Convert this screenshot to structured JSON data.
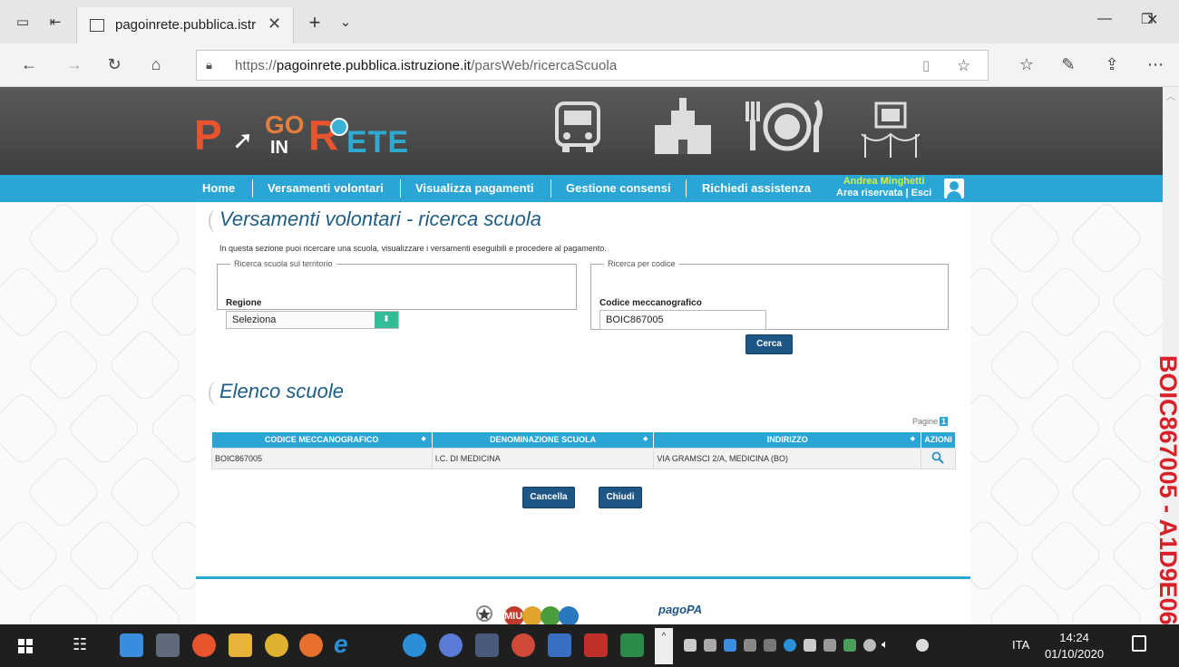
{
  "browser": {
    "tab_title": "pagoinrete.pubblica.istr",
    "url_prefix": "https://",
    "url_domain": "pagoinrete.pubblica.istruzione.it",
    "url_path": "/parsWeb/ricercaScuola"
  },
  "header": {
    "logo_p": "P",
    "logo_go": "GO",
    "logo_in": "IN",
    "logo_r": "R",
    "logo_ete": "ETE",
    "nav": [
      "Home",
      "Versamenti volontari",
      "Visualizza pagamenti",
      "Gestione consensi",
      "Richiedi assistenza"
    ],
    "user_name": "Andrea Minghetti",
    "user_area": "Area riservata | Esci"
  },
  "main": {
    "title": "Versamenti volontari - ricerca scuola",
    "intro": "In questa sezione puoi ricercare una scuola, visualizzare i versamenti eseguibili e procedere al pagamento.",
    "territorio_legend": "Ricerca scuola sul territorio",
    "regione_label": "Regione",
    "regione_value": "Seleziona",
    "codice_legend": "Ricerca per codice",
    "codice_label": "Codice meccanografico",
    "codice_value": "BOIC867005",
    "cerca_label": "Cerca",
    "elenco_title": "Elenco scuole",
    "pagine_label": "Pagine",
    "pagine_num": "1",
    "table": {
      "headers": [
        "CODICE MECCANOGRAFICO",
        "DENOMINAZIONE SCUOLA",
        "INDIRIZZO",
        "AZIONI"
      ],
      "rows": [
        [
          "BOIC867005",
          "I.C. DI MEDICINA",
          "VIA GRAMSCI 2/A, MEDICINA (BO)"
        ]
      ]
    },
    "cancella_label": "Cancella",
    "chiudi_label": "Chiudi",
    "footer_pagopa": "pagoPA",
    "footer_miur": "MIUR"
  },
  "watermark": "BOIC867005 - A1D9E06",
  "taskbar": {
    "lang": "ITA",
    "time": "14:24",
    "date": "01/10/2020"
  },
  "colors": {
    "nav_blue": "#2aa6d6",
    "button_navy": "#1e5685",
    "title_blue": "#1d5d86",
    "logo_orange": "#e8542e",
    "watermark_red": "#d8202a"
  }
}
